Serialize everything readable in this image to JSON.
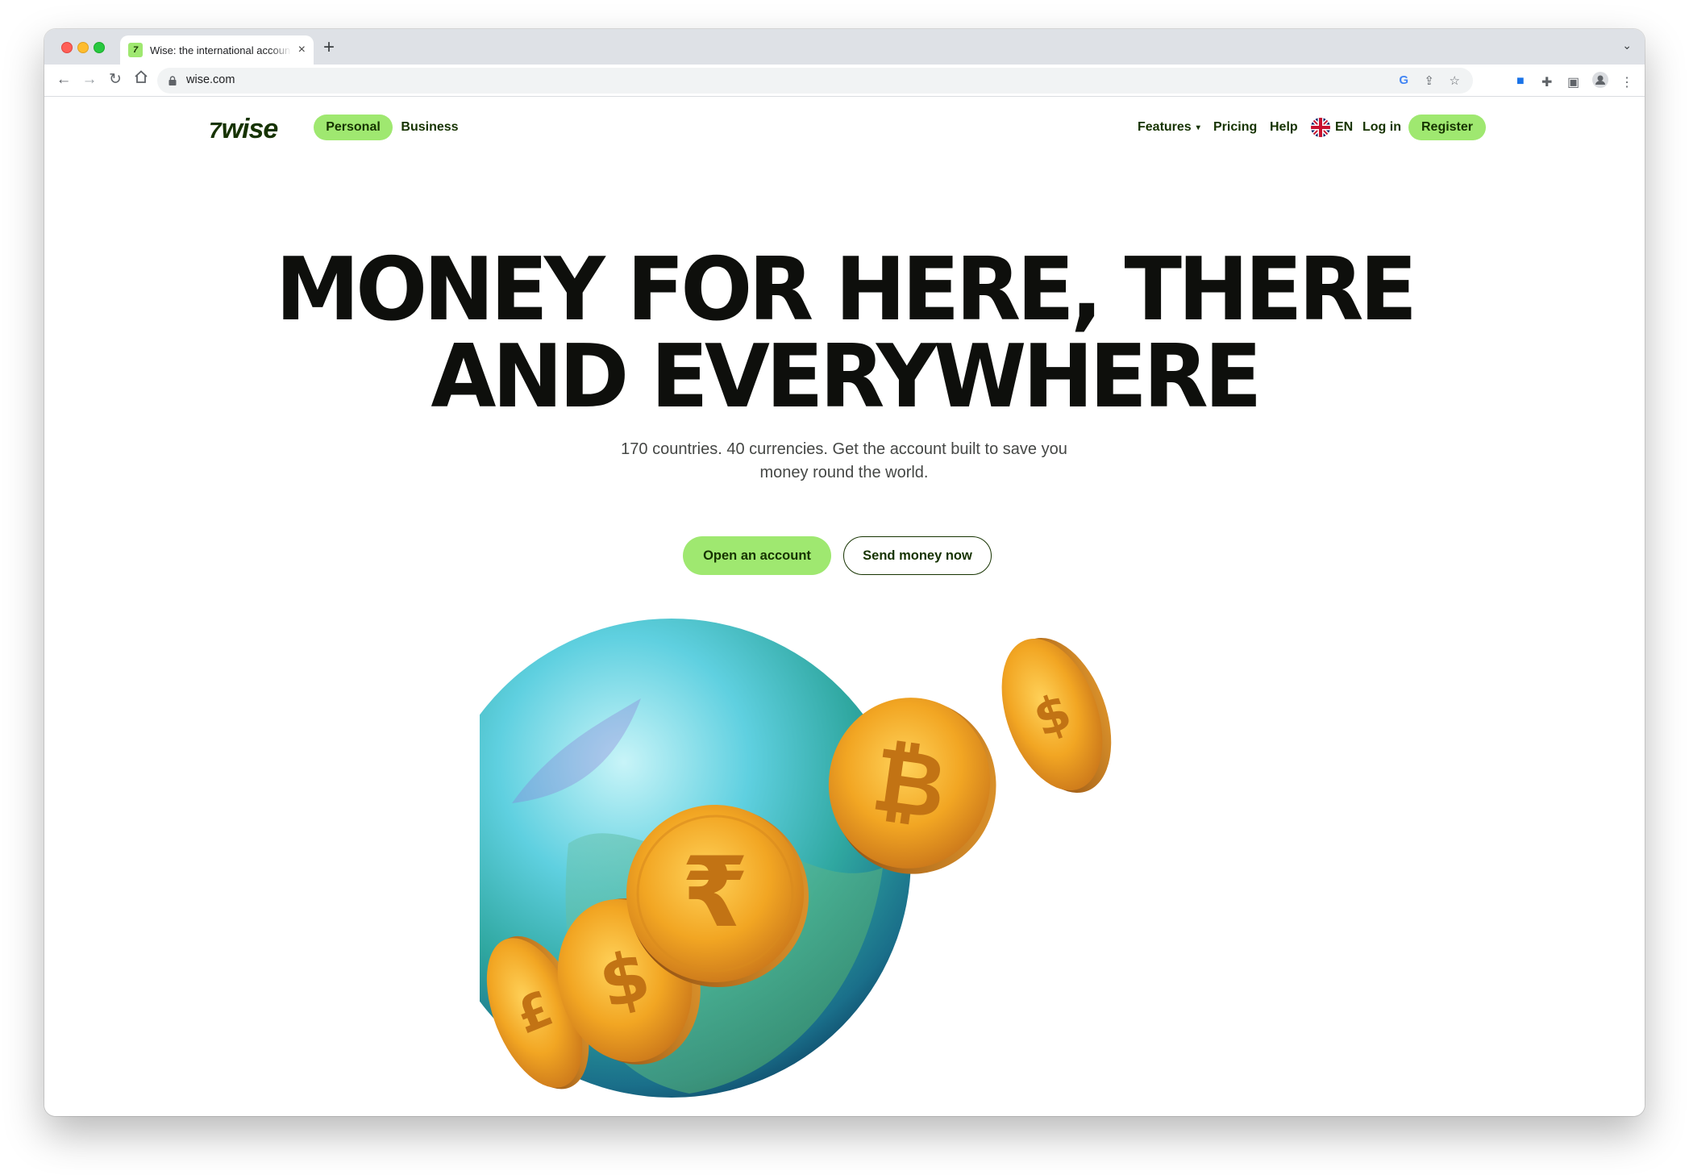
{
  "browser": {
    "tab_title": "Wise: the international account",
    "tab_favicon": "7",
    "url": "wise.com",
    "new_tab_icon": "+",
    "close_icon": "×"
  },
  "header": {
    "logo": "wise",
    "logo_mark": "7",
    "personal": "Personal",
    "business": "Business",
    "features": "Features",
    "pricing": "Pricing",
    "help": "Help",
    "language": "EN",
    "login": "Log in",
    "register": "Register"
  },
  "hero": {
    "title_line1": "MONEY FOR HERE, THERE",
    "title_line2": "AND EVERYWHERE",
    "subtitle": "170 countries. 40 currencies. Get the account built to save you money round the world.",
    "cta_primary": "Open an account",
    "cta_secondary": "Send money now"
  },
  "illustration": {
    "coin_symbols": [
      "₹",
      "₿",
      "$",
      "£"
    ]
  },
  "colors": {
    "brand_green": "#9fe870",
    "forest_green": "#163300",
    "text_dark": "#0e0f0c"
  }
}
